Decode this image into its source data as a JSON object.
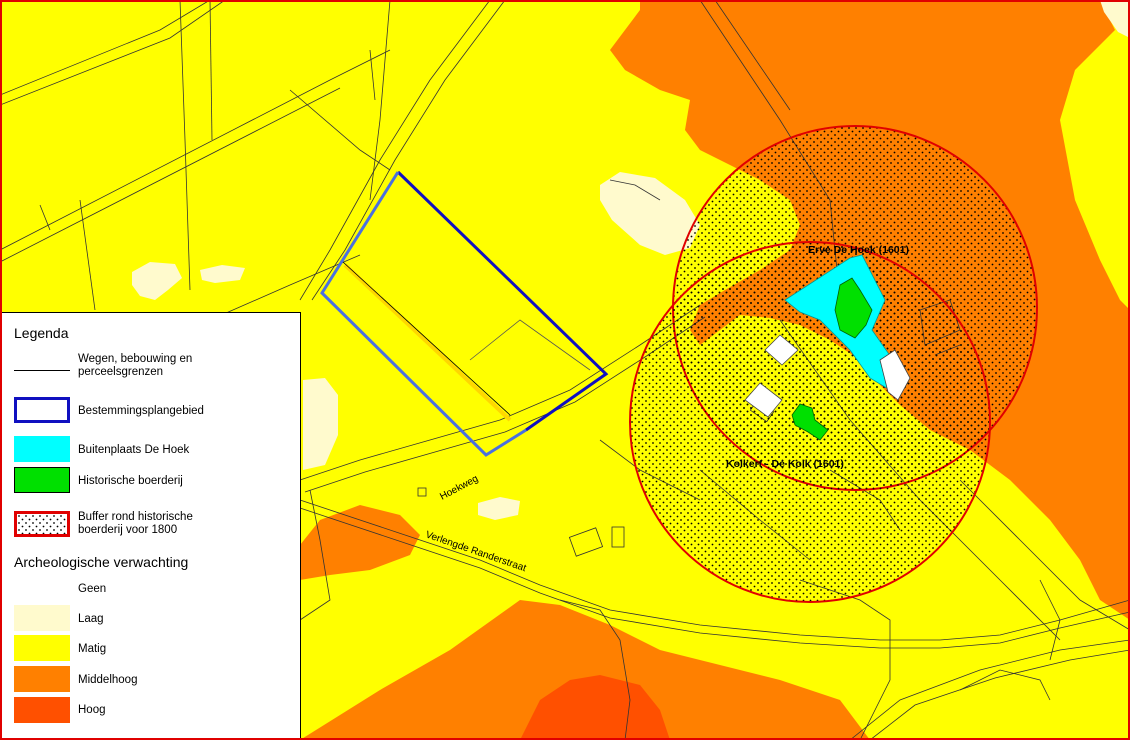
{
  "colors": {
    "geen": "#ffffff",
    "laag": "#fffacd",
    "matig": "#ffff00",
    "middelhoog": "#ff8000",
    "hoog": "#ff5000",
    "buitenplaats": "#00ffff",
    "boerderij": "#00e000",
    "plangebied": "#1010c0",
    "buffer": "#e00000"
  },
  "labels": {
    "erve": "Erve De Hoek (1601)",
    "kolk": "Kolkert - De Kolk (1601)",
    "hoekweg": "Hoekweg",
    "randerstraat": "Verlengde Randerstraat"
  },
  "legend": {
    "title": "Legenda",
    "roads": "Wegen, bebouwing en perceelsgrenzen",
    "plangebied": "Bestemmingsplangebied",
    "buitenplaats": "Buitenplaats De Hoek",
    "boerderij": "Historische boerderij",
    "buffer": "Buffer rond historische boerderij voor 1800",
    "arch_title": "Archeologische verwachting",
    "classes": [
      "Geen",
      "Laag",
      "Matig",
      "Middelhoog",
      "Hoog"
    ]
  }
}
